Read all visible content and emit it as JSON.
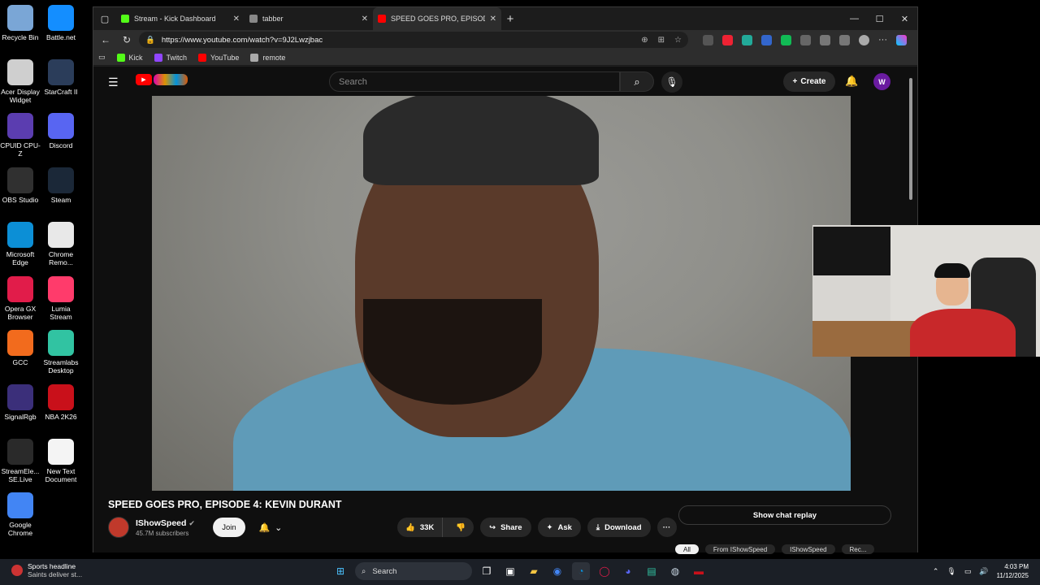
{
  "desktop": {
    "icons": [
      {
        "label": "Recycle Bin",
        "icon": "recycle-bin-icon",
        "color": "#7aa6d6"
      },
      {
        "label": "Battle.net",
        "icon": "battlenet-icon",
        "color": "#148eff"
      },
      {
        "label": "Acer Display Widget",
        "icon": "acer-widget-icon",
        "color": "#cfcfcf"
      },
      {
        "label": "StarCraft II",
        "icon": "starcraft-icon",
        "color": "#2b3d5a"
      },
      {
        "label": "CPUID CPU-Z",
        "icon": "cpuz-icon",
        "color": "#5b3db0"
      },
      {
        "label": "Discord",
        "icon": "discord-icon",
        "color": "#5865f2"
      },
      {
        "label": "OBS Studio",
        "icon": "obs-icon",
        "color": "#303030"
      },
      {
        "label": "Steam",
        "icon": "steam-icon",
        "color": "#1b2838"
      },
      {
        "label": "Microsoft Edge",
        "icon": "edge-icon",
        "color": "#0c8fd6"
      },
      {
        "label": "Chrome Remo...",
        "icon": "chrome-remote-icon",
        "color": "#e8e8e8"
      },
      {
        "label": "Opera GX Browser",
        "icon": "opera-gx-icon",
        "color": "#e11c4a"
      },
      {
        "label": "Lumia Stream",
        "icon": "lumia-icon",
        "color": "#ff3b6b"
      },
      {
        "label": "GCC",
        "icon": "gcc-icon",
        "color": "#f26b1d"
      },
      {
        "label": "Streamlabs Desktop",
        "icon": "streamlabs-icon",
        "color": "#31c3a2"
      },
      {
        "label": "SignalRgb",
        "icon": "signalrgb-icon",
        "color": "#3b2f7a"
      },
      {
        "label": "NBA 2K26",
        "icon": "nba2k-icon",
        "color": "#c9101a"
      },
      {
        "label": "StreamEle... SE.Live",
        "icon": "streamelements-icon",
        "color": "#2a2a2a"
      },
      {
        "label": "New Text Document",
        "icon": "text-document-icon",
        "color": "#f4f4f4"
      },
      {
        "label": "Google Chrome",
        "icon": "chrome-icon",
        "color": "#4285f4"
      }
    ]
  },
  "browser": {
    "tabs": [
      {
        "title": "Stream - Kick Dashboard",
        "fav_color": "#53fc18"
      },
      {
        "title": "tabber",
        "fav_color": "#888888"
      },
      {
        "title": "SPEED GOES PRO, EPISODE",
        "fav_color": "#ff0000"
      }
    ],
    "url": "https://www.youtube.com/watch?v=9J2Lwzjbac",
    "bookmarks": [
      {
        "label": "Kick",
        "color": "#53fc18"
      },
      {
        "label": "Twitch",
        "color": "#9146ff"
      },
      {
        "label": "YouTube",
        "color": "#ff0000"
      },
      {
        "label": "remote",
        "color": "#aaaaaa"
      }
    ]
  },
  "youtube": {
    "search_placeholder": "Search",
    "create_label": "Create",
    "avatar_letter": "W",
    "video_title": "SPEED GOES PRO, EPISODE 4: KEVIN DURANT",
    "channel_name": "IShowSpeed",
    "subscribers": "45.7M subscribers",
    "join_label": "Join",
    "like_count": "33K",
    "share_label": "Share",
    "ask_label": "Ask",
    "download_label": "Download",
    "chat_replay_label": "Show chat replay",
    "chips": [
      "All",
      "From IShowSpeed",
      "IShowSpeed",
      "Rec..."
    ]
  },
  "taskbar": {
    "news_title": "Sports headline",
    "news_sub": "Saints deliver st...",
    "search_label": "Search",
    "time": "4:03 PM",
    "date": "11/12/2025"
  }
}
